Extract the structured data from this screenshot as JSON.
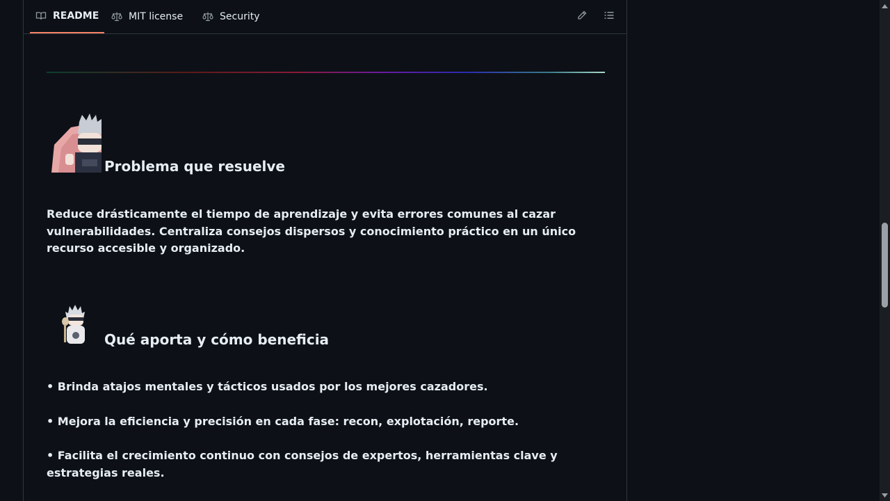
{
  "tabs": [
    {
      "label": "README",
      "icon": "book-icon",
      "active": true
    },
    {
      "label": "MIT license",
      "icon": "law-icon",
      "active": false
    },
    {
      "label": "Security",
      "icon": "law-icon",
      "active": false
    }
  ],
  "toolbar": {
    "edit_icon": "pencil-icon",
    "outline_icon": "list-unordered-icon"
  },
  "colors": {
    "background": "#0d1117",
    "border": "#30363d",
    "active_tab_underline": "#f78166",
    "text": "#e6edf3"
  },
  "sections": {
    "problem": {
      "heading": "Problema que resuelve",
      "body": "Reduce drásticamente el tiempo de aprendizaje y evita errores comunes al cazar vulnerabilidades. Centraliza consejos dispersos y conocimiento práctico en un único recurso accesible y organizado."
    },
    "benefit": {
      "heading": "Qué aporta y cómo beneficia",
      "bullets": [
        "• Brinda atajos mentales y tácticos usados por los mejores cazadores.",
        "• Mejora la eficiencia y precisión en cada fase: recon, explotación, reporte.",
        "• Facilita el crecimiento continuo con consejos de expertos, herramientas clave y estrategias reales."
      ]
    }
  }
}
